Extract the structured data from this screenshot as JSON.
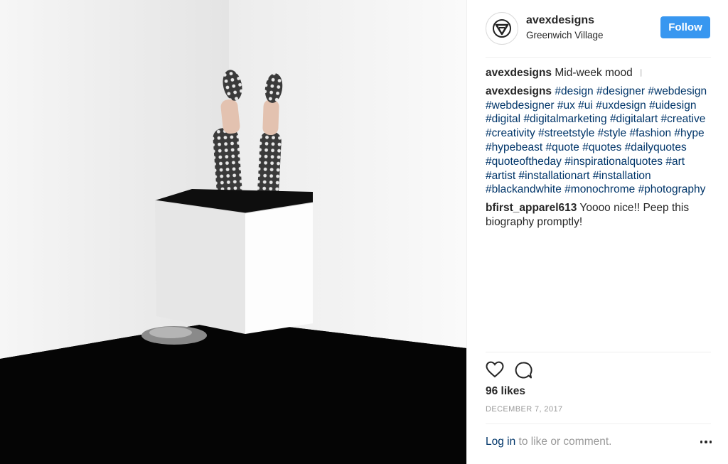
{
  "post": {
    "username": "avexdesigns",
    "location": "Greenwich Village",
    "follow_label": "Follow",
    "comments": [
      {
        "user": "avexdesigns",
        "segments": [
          {
            "text": "Mid-week mood",
            "tag": false
          }
        ]
      },
      {
        "user": "avexdesigns",
        "segments": [
          {
            "text": "#design",
            "tag": true
          },
          {
            "text": " ",
            "tag": false
          },
          {
            "text": "#designer",
            "tag": true
          },
          {
            "text": " ",
            "tag": false
          },
          {
            "text": "#webdesign",
            "tag": true
          },
          {
            "text": " ",
            "tag": false
          },
          {
            "text": "#webdesigner",
            "tag": true
          },
          {
            "text": " ",
            "tag": false
          },
          {
            "text": "#ux",
            "tag": true
          },
          {
            "text": " ",
            "tag": false
          },
          {
            "text": "#ui",
            "tag": true
          },
          {
            "text": " ",
            "tag": false
          },
          {
            "text": "#uxdesign",
            "tag": true
          },
          {
            "text": " ",
            "tag": false
          },
          {
            "text": "#uidesign",
            "tag": true
          },
          {
            "text": " ",
            "tag": false
          },
          {
            "text": "#digital",
            "tag": true
          },
          {
            "text": " ",
            "tag": false
          },
          {
            "text": "#digitalmarketing",
            "tag": true
          },
          {
            "text": " ",
            "tag": false
          },
          {
            "text": "#digitalart",
            "tag": true
          },
          {
            "text": " ",
            "tag": false
          },
          {
            "text": "#creative",
            "tag": true
          },
          {
            "text": " ",
            "tag": false
          },
          {
            "text": "#creativity",
            "tag": true
          },
          {
            "text": " ",
            "tag": false
          },
          {
            "text": "#streetstyle",
            "tag": true
          },
          {
            "text": " ",
            "tag": false
          },
          {
            "text": "#style",
            "tag": true
          },
          {
            "text": " ",
            "tag": false
          },
          {
            "text": "#fashion",
            "tag": true
          },
          {
            "text": " ",
            "tag": false
          },
          {
            "text": "#hype",
            "tag": true
          },
          {
            "text": " ",
            "tag": false
          },
          {
            "text": "#hypebeast",
            "tag": true
          },
          {
            "text": " ",
            "tag": false
          },
          {
            "text": "#quote",
            "tag": true
          },
          {
            "text": " ",
            "tag": false
          },
          {
            "text": "#quotes",
            "tag": true
          },
          {
            "text": " ",
            "tag": false
          },
          {
            "text": "#dailyquotes",
            "tag": true
          },
          {
            "text": " ",
            "tag": false
          },
          {
            "text": "#quoteoftheday",
            "tag": true
          },
          {
            "text": " ",
            "tag": false
          },
          {
            "text": "#inspirationalquotes",
            "tag": true
          },
          {
            "text": " ",
            "tag": false
          },
          {
            "text": "#art",
            "tag": true
          },
          {
            "text": " ",
            "tag": false
          },
          {
            "text": "#artist",
            "tag": true
          },
          {
            "text": " ",
            "tag": false
          },
          {
            "text": "#installationart",
            "tag": true
          },
          {
            "text": " ",
            "tag": false
          },
          {
            "text": "#installation",
            "tag": true
          },
          {
            "text": " ",
            "tag": false
          },
          {
            "text": "#blackandwhite",
            "tag": true
          },
          {
            "text": " ",
            "tag": false
          },
          {
            "text": "#monochrome",
            "tag": true
          },
          {
            "text": " ",
            "tag": false
          },
          {
            "text": "#photography",
            "tag": true
          }
        ]
      },
      {
        "user": "bfirst_apparel613",
        "segments": [
          {
            "text": "Yoooo nice!! Peep this biography promptly!",
            "tag": false
          }
        ]
      }
    ],
    "likes": "96 likes",
    "date": "December 7, 2017",
    "login_link": "Log in",
    "login_rest": " to like or comment."
  },
  "icons": {
    "avatar": "avex-logo-icon",
    "like": "heart-icon",
    "comment": "comment-bubble-icon",
    "more": "more-options-icon"
  },
  "colors": {
    "follow_button": "#3897f0",
    "hashtag": "#003569",
    "muted": "#999999"
  }
}
